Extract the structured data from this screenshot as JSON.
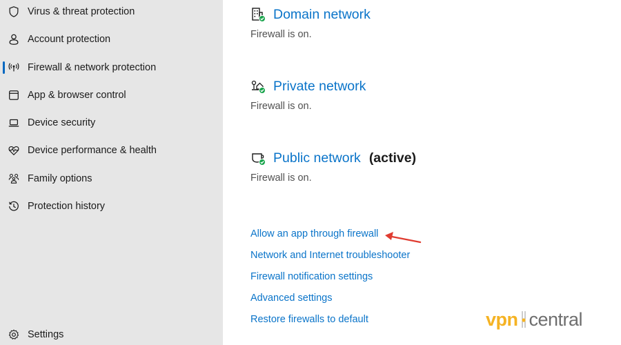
{
  "sidebar": {
    "items": [
      {
        "label": "Virus & threat protection",
        "icon": "shield-icon",
        "active": false
      },
      {
        "label": "Account protection",
        "icon": "person-icon",
        "active": false
      },
      {
        "label": "Firewall & network protection",
        "icon": "antenna-icon",
        "active": true
      },
      {
        "label": "App & browser control",
        "icon": "browser-window-icon",
        "active": false
      },
      {
        "label": "Device security",
        "icon": "laptop-icon",
        "active": false
      },
      {
        "label": "Device performance & health",
        "icon": "heart-pulse-icon",
        "active": false
      },
      {
        "label": "Family options",
        "icon": "family-icon",
        "active": false
      },
      {
        "label": "Protection history",
        "icon": "history-icon",
        "active": false
      }
    ],
    "settings_label": "Settings"
  },
  "networks": [
    {
      "name": "Domain network",
      "status": "Firewall is on.",
      "icon": "domain-building-icon",
      "active_label": ""
    },
    {
      "name": "Private network",
      "status": "Firewall is on.",
      "icon": "private-home-network-icon",
      "active_label": ""
    },
    {
      "name": "Public network",
      "status": "Firewall is on.",
      "icon": "public-coffee-network-icon",
      "active_label": "(active)"
    }
  ],
  "links": [
    "Allow an app through firewall",
    "Network and Internet troubleshooter",
    "Firewall notification settings",
    "Advanced settings",
    "Restore firewalls to default"
  ],
  "annotation": {
    "arrow_target": "Allow an app through firewall",
    "arrow_color": "#e03c31"
  },
  "colors": {
    "link": "#0a74c9",
    "accent": "#0067c0",
    "ok_badge": "#16a34a",
    "sidebar_bg": "#e6e6e6"
  },
  "watermark": {
    "part1": "vpn",
    "part2": "central"
  }
}
